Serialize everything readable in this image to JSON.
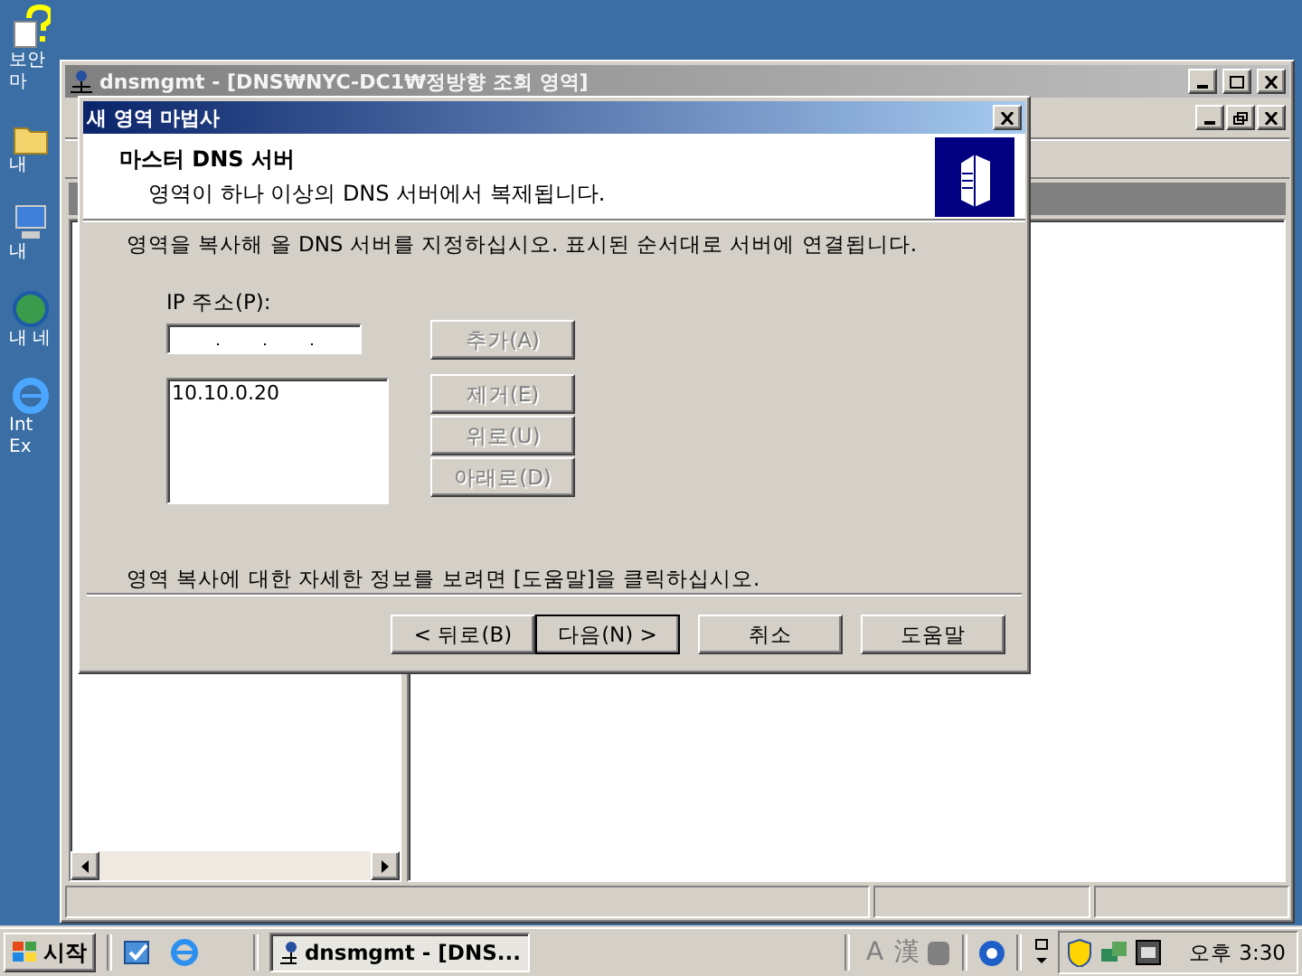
{
  "desktop_icons": [
    {
      "kind": "help",
      "lines": [
        "보안",
        "마"
      ]
    },
    {
      "kind": "folder",
      "lines": [
        "내"
      ]
    },
    {
      "kind": "computer",
      "lines": [
        "내"
      ]
    },
    {
      "kind": "globe",
      "lines": [
        "내 네"
      ]
    },
    {
      "kind": "ie",
      "lines": [
        "Int",
        "Ex"
      ]
    }
  ],
  "mmc": {
    "title": "dnsmgmt - [DNS₩NYC-DC1₩정방향 조회 영역]"
  },
  "dialog": {
    "title": "새 영역 마법사",
    "header_title": "마스터 DNS 서버",
    "header_subtitle": "영역이 하나 이상의 DNS 서버에서 복제됩니다.",
    "instruction": "영역을 복사해 올 DNS 서버를 지정하십시오. 표시된 순서대로 서버에 연결됩니다.",
    "ip_label": "IP 주소(P):",
    "add_button": {
      "label": "추가(A)",
      "disabled": true
    },
    "servers": [
      "10.10.0.20"
    ],
    "side_buttons": [
      {
        "label": "제거(E)",
        "disabled": true
      },
      {
        "label": "위로(U)",
        "disabled": true
      },
      {
        "label": "아래로(D)",
        "disabled": true
      }
    ],
    "help_text": "영역 복사에 대한 자세한 정보를 보려면 [도움말]을 클릭하십시오.",
    "nav_buttons": [
      {
        "label": "< 뒤로(B)",
        "default": false
      },
      {
        "label": "다음(N) >",
        "default": true
      },
      {
        "label": "취소",
        "default": false
      },
      {
        "label": "도움말",
        "default": false
      }
    ]
  },
  "taskbar": {
    "start": "시작",
    "task": "dnsmgmt - [DNS...",
    "ime": [
      "A",
      "漢"
    ],
    "clock": "오후 3:30"
  }
}
